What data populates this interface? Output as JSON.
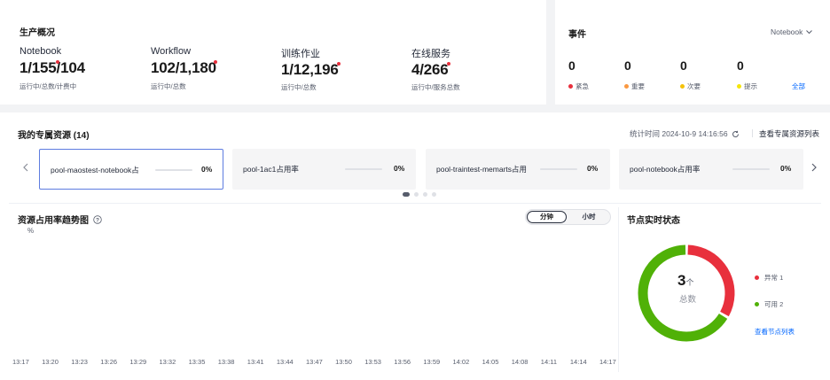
{
  "production": {
    "title": "生产概况",
    "metrics": [
      {
        "label": "Notebook",
        "value": "1/155/104",
        "sub": "运行中/总数/计费中"
      },
      {
        "label": "Workflow",
        "value": "102/1,180",
        "sub": "运行中/总数"
      },
      {
        "label": "训练作业",
        "value": "1/12,196",
        "sub": "运行中/总数"
      },
      {
        "label": "在线服务",
        "value": "4/266",
        "sub": "运行中/服务总数"
      }
    ]
  },
  "events": {
    "title": "事件",
    "select_value": "Notebook",
    "items": [
      {
        "count": "0",
        "label": "紧急",
        "color": "#e8303d"
      },
      {
        "count": "0",
        "label": "重要",
        "color": "#fa9841"
      },
      {
        "count": "0",
        "label": "次要",
        "color": "#f5c20a"
      },
      {
        "count": "0",
        "label": "提示",
        "color": "#f5e50a"
      }
    ],
    "all_link": "全部"
  },
  "resources": {
    "title": "我的专属资源 (14)",
    "stat_time": "统计时间 2024-10-9 14:16:56",
    "list_link": "查看专属资源列表",
    "pools": [
      {
        "name": "pool-maostest-notebook占",
        "pct": "0%",
        "usage": 0
      },
      {
        "name": "pool-1ac1占用率",
        "pct": "0%",
        "usage": 0
      },
      {
        "name": "pool-traintest-memarts占用",
        "pct": "0%",
        "usage": 0
      },
      {
        "name": "pool-notebook占用率",
        "pct": "0%",
        "usage": 0
      }
    ]
  },
  "trend": {
    "title": "资源占用率趋势图",
    "toggle_on": "分钟",
    "toggle_off": "小时"
  },
  "chart_data": {
    "type": "line",
    "ylabel": "%",
    "x": [
      "13:17",
      "13:20",
      "13:23",
      "13:26",
      "13:29",
      "13:32",
      "13:35",
      "13:38",
      "13:41",
      "13:44",
      "13:47",
      "13:50",
      "13:53",
      "13:56",
      "13:59",
      "14:02",
      "14:05",
      "14:08",
      "14:11",
      "14:14",
      "14:17"
    ],
    "series": []
  },
  "nodes": {
    "title": "节点实时状态",
    "total": "3",
    "unit": "个",
    "total_label": "总数",
    "abnormal_label": "异常 1",
    "available_label": "可用 2",
    "abnormal": 1,
    "available": 2,
    "abnormal_color": "#e8303d",
    "available_color": "#50b107",
    "link": "查看节点列表"
  }
}
